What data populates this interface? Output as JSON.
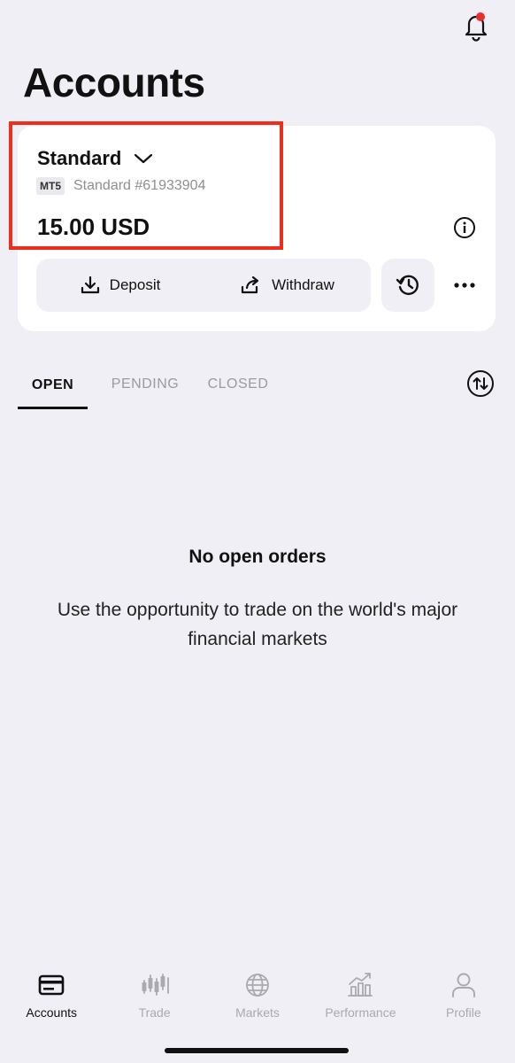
{
  "header": {
    "title": "Accounts",
    "notification_dot": true
  },
  "account": {
    "type_label": "Standard",
    "platform_badge": "MT5",
    "account_number": "Standard #61933904",
    "balance": "15.00 USD",
    "deposit_label": "Deposit",
    "withdraw_label": "Withdraw"
  },
  "tabs": [
    {
      "label": "OPEN",
      "active": true
    },
    {
      "label": "PENDING",
      "active": false
    },
    {
      "label": "CLOSED",
      "active": false
    }
  ],
  "empty_state": {
    "title": "No open orders",
    "message": "Use the opportunity to trade on the world's major financial markets"
  },
  "bottom_nav": [
    {
      "label": "Accounts",
      "icon": "card-icon",
      "active": true
    },
    {
      "label": "Trade",
      "icon": "candles-icon",
      "active": false
    },
    {
      "label": "Markets",
      "icon": "globe-icon",
      "active": false
    },
    {
      "label": "Performance",
      "icon": "growth-chart-icon",
      "active": false
    },
    {
      "label": "Profile",
      "icon": "person-icon",
      "active": false
    }
  ],
  "colors": {
    "background": "#f0eff5",
    "card": "#ffffff",
    "highlight_border": "#ee2d1c",
    "notification_dot": "#e8302a",
    "inactive_text": "#9a9a9f"
  }
}
